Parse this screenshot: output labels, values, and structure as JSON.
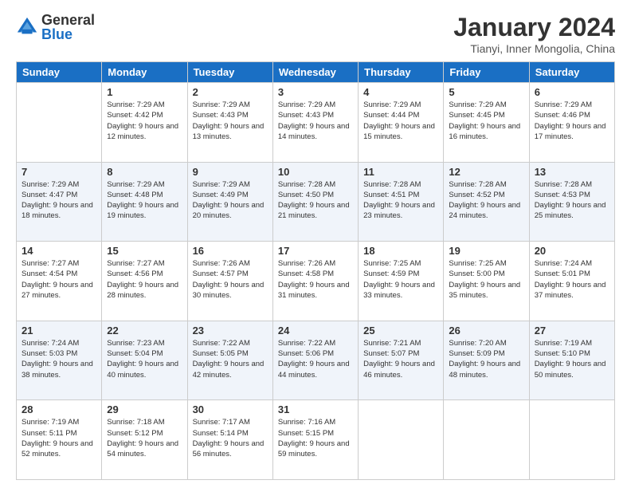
{
  "logo": {
    "general": "General",
    "blue": "Blue"
  },
  "title": "January 2024",
  "location": "Tianyi, Inner Mongolia, China",
  "headers": [
    "Sunday",
    "Monday",
    "Tuesday",
    "Wednesday",
    "Thursday",
    "Friday",
    "Saturday"
  ],
  "weeks": [
    [
      {
        "day": "",
        "sunrise": "",
        "sunset": "",
        "daylight": ""
      },
      {
        "day": "1",
        "sunrise": "Sunrise: 7:29 AM",
        "sunset": "Sunset: 4:42 PM",
        "daylight": "Daylight: 9 hours and 12 minutes."
      },
      {
        "day": "2",
        "sunrise": "Sunrise: 7:29 AM",
        "sunset": "Sunset: 4:43 PM",
        "daylight": "Daylight: 9 hours and 13 minutes."
      },
      {
        "day": "3",
        "sunrise": "Sunrise: 7:29 AM",
        "sunset": "Sunset: 4:43 PM",
        "daylight": "Daylight: 9 hours and 14 minutes."
      },
      {
        "day": "4",
        "sunrise": "Sunrise: 7:29 AM",
        "sunset": "Sunset: 4:44 PM",
        "daylight": "Daylight: 9 hours and 15 minutes."
      },
      {
        "day": "5",
        "sunrise": "Sunrise: 7:29 AM",
        "sunset": "Sunset: 4:45 PM",
        "daylight": "Daylight: 9 hours and 16 minutes."
      },
      {
        "day": "6",
        "sunrise": "Sunrise: 7:29 AM",
        "sunset": "Sunset: 4:46 PM",
        "daylight": "Daylight: 9 hours and 17 minutes."
      }
    ],
    [
      {
        "day": "7",
        "sunrise": "Sunrise: 7:29 AM",
        "sunset": "Sunset: 4:47 PM",
        "daylight": "Daylight: 9 hours and 18 minutes."
      },
      {
        "day": "8",
        "sunrise": "Sunrise: 7:29 AM",
        "sunset": "Sunset: 4:48 PM",
        "daylight": "Daylight: 9 hours and 19 minutes."
      },
      {
        "day": "9",
        "sunrise": "Sunrise: 7:29 AM",
        "sunset": "Sunset: 4:49 PM",
        "daylight": "Daylight: 9 hours and 20 minutes."
      },
      {
        "day": "10",
        "sunrise": "Sunrise: 7:28 AM",
        "sunset": "Sunset: 4:50 PM",
        "daylight": "Daylight: 9 hours and 21 minutes."
      },
      {
        "day": "11",
        "sunrise": "Sunrise: 7:28 AM",
        "sunset": "Sunset: 4:51 PM",
        "daylight": "Daylight: 9 hours and 23 minutes."
      },
      {
        "day": "12",
        "sunrise": "Sunrise: 7:28 AM",
        "sunset": "Sunset: 4:52 PM",
        "daylight": "Daylight: 9 hours and 24 minutes."
      },
      {
        "day": "13",
        "sunrise": "Sunrise: 7:28 AM",
        "sunset": "Sunset: 4:53 PM",
        "daylight": "Daylight: 9 hours and 25 minutes."
      }
    ],
    [
      {
        "day": "14",
        "sunrise": "Sunrise: 7:27 AM",
        "sunset": "Sunset: 4:54 PM",
        "daylight": "Daylight: 9 hours and 27 minutes."
      },
      {
        "day": "15",
        "sunrise": "Sunrise: 7:27 AM",
        "sunset": "Sunset: 4:56 PM",
        "daylight": "Daylight: 9 hours and 28 minutes."
      },
      {
        "day": "16",
        "sunrise": "Sunrise: 7:26 AM",
        "sunset": "Sunset: 4:57 PM",
        "daylight": "Daylight: 9 hours and 30 minutes."
      },
      {
        "day": "17",
        "sunrise": "Sunrise: 7:26 AM",
        "sunset": "Sunset: 4:58 PM",
        "daylight": "Daylight: 9 hours and 31 minutes."
      },
      {
        "day": "18",
        "sunrise": "Sunrise: 7:25 AM",
        "sunset": "Sunset: 4:59 PM",
        "daylight": "Daylight: 9 hours and 33 minutes."
      },
      {
        "day": "19",
        "sunrise": "Sunrise: 7:25 AM",
        "sunset": "Sunset: 5:00 PM",
        "daylight": "Daylight: 9 hours and 35 minutes."
      },
      {
        "day": "20",
        "sunrise": "Sunrise: 7:24 AM",
        "sunset": "Sunset: 5:01 PM",
        "daylight": "Daylight: 9 hours and 37 minutes."
      }
    ],
    [
      {
        "day": "21",
        "sunrise": "Sunrise: 7:24 AM",
        "sunset": "Sunset: 5:03 PM",
        "daylight": "Daylight: 9 hours and 38 minutes."
      },
      {
        "day": "22",
        "sunrise": "Sunrise: 7:23 AM",
        "sunset": "Sunset: 5:04 PM",
        "daylight": "Daylight: 9 hours and 40 minutes."
      },
      {
        "day": "23",
        "sunrise": "Sunrise: 7:22 AM",
        "sunset": "Sunset: 5:05 PM",
        "daylight": "Daylight: 9 hours and 42 minutes."
      },
      {
        "day": "24",
        "sunrise": "Sunrise: 7:22 AM",
        "sunset": "Sunset: 5:06 PM",
        "daylight": "Daylight: 9 hours and 44 minutes."
      },
      {
        "day": "25",
        "sunrise": "Sunrise: 7:21 AM",
        "sunset": "Sunset: 5:07 PM",
        "daylight": "Daylight: 9 hours and 46 minutes."
      },
      {
        "day": "26",
        "sunrise": "Sunrise: 7:20 AM",
        "sunset": "Sunset: 5:09 PM",
        "daylight": "Daylight: 9 hours and 48 minutes."
      },
      {
        "day": "27",
        "sunrise": "Sunrise: 7:19 AM",
        "sunset": "Sunset: 5:10 PM",
        "daylight": "Daylight: 9 hours and 50 minutes."
      }
    ],
    [
      {
        "day": "28",
        "sunrise": "Sunrise: 7:19 AM",
        "sunset": "Sunset: 5:11 PM",
        "daylight": "Daylight: 9 hours and 52 minutes."
      },
      {
        "day": "29",
        "sunrise": "Sunrise: 7:18 AM",
        "sunset": "Sunset: 5:12 PM",
        "daylight": "Daylight: 9 hours and 54 minutes."
      },
      {
        "day": "30",
        "sunrise": "Sunrise: 7:17 AM",
        "sunset": "Sunset: 5:14 PM",
        "daylight": "Daylight: 9 hours and 56 minutes."
      },
      {
        "day": "31",
        "sunrise": "Sunrise: 7:16 AM",
        "sunset": "Sunset: 5:15 PM",
        "daylight": "Daylight: 9 hours and 59 minutes."
      },
      {
        "day": "",
        "sunrise": "",
        "sunset": "",
        "daylight": ""
      },
      {
        "day": "",
        "sunrise": "",
        "sunset": "",
        "daylight": ""
      },
      {
        "day": "",
        "sunrise": "",
        "sunset": "",
        "daylight": ""
      }
    ]
  ]
}
